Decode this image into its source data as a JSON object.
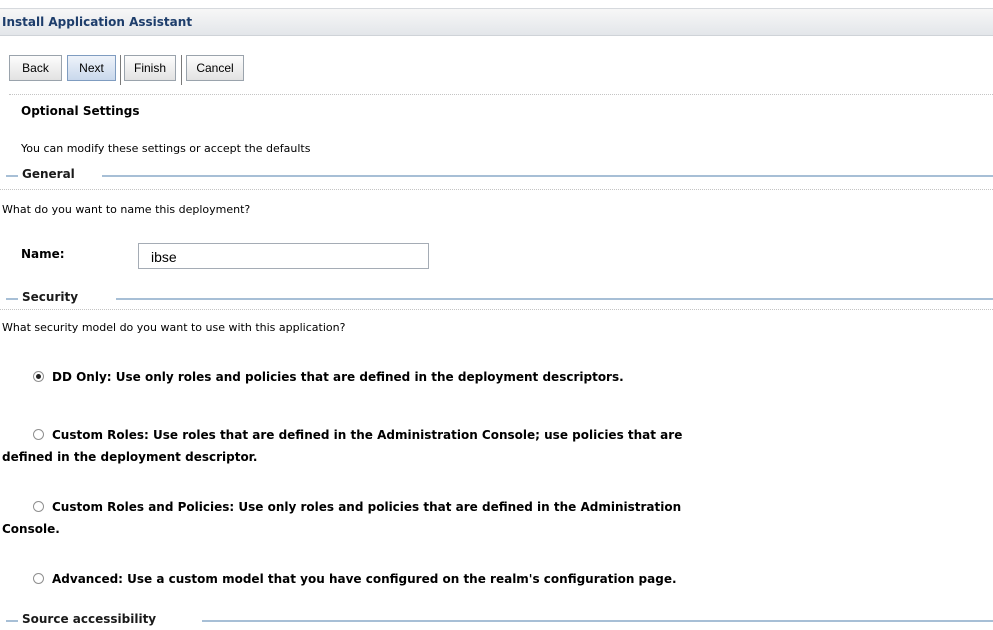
{
  "window": {
    "title": "Install Application Assistant"
  },
  "toolbar": {
    "back_label": "Back",
    "next_label": "Next",
    "finish_label": "Finish",
    "cancel_label": "Cancel"
  },
  "page": {
    "section_title": "Optional Settings",
    "section_desc": "You can modify these settings or accept the defaults"
  },
  "general": {
    "legend": "General",
    "question": "What do you want to name this deployment?",
    "name_label": "Name:",
    "name_value": "ibse"
  },
  "security": {
    "legend": "Security",
    "question": "What security model do you want to use with this application?",
    "options": [
      {
        "label_line1": "DD Only: Use only roles and policies that are defined in the deployment descriptors.",
        "label_line2": "",
        "selected": true
      },
      {
        "label_line1": "Custom Roles: Use roles that are defined in the Administration Console; use policies that are",
        "label_line2": "defined in the deployment descriptor.",
        "selected": false
      },
      {
        "label_line1": "Custom Roles and Policies: Use only roles and policies that are defined in the Administration",
        "label_line2": "Console.",
        "selected": false
      },
      {
        "label_line1": "Advanced: Use a custom model that you have configured on the realm's configuration page.",
        "label_line2": "",
        "selected": false
      }
    ]
  },
  "source_accessibility": {
    "legend": "Source accessibility"
  },
  "colors": {
    "title_text": "#1d3d6b",
    "legend_line": "#a7bfd6",
    "primary_button": "#c9d8ec"
  }
}
